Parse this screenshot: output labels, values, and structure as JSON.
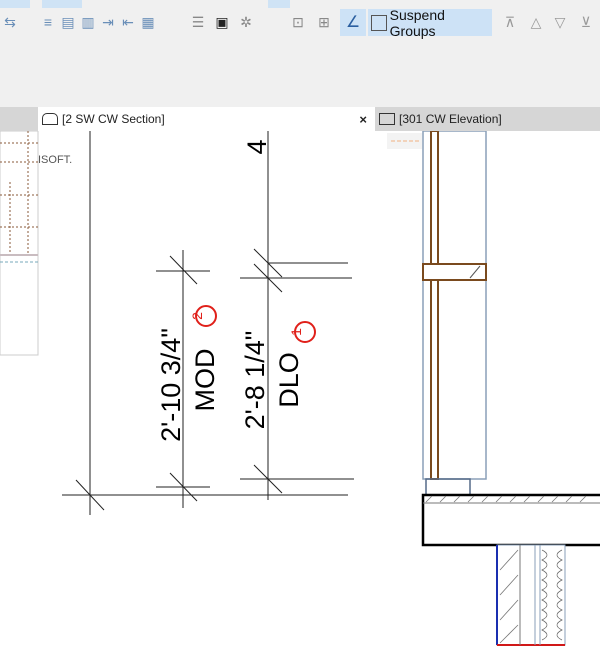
{
  "toolbar": {
    "suspend_groups_label": "Suspend Groups"
  },
  "tabs": [
    {
      "label": "[2 SW CW Section]",
      "active": true
    },
    {
      "label": "[301 CW Elevation]",
      "active": false
    }
  ],
  "close_symbol": "×",
  "side_panel": {
    "text": "ISOFT."
  },
  "section": {
    "grid_label": "4",
    "dims": [
      {
        "value": "2'-10 3/4\"",
        "label": "MOD",
        "markup": "2"
      },
      {
        "value": "2'-8 1/4\"",
        "label": "DLO",
        "markup": "1"
      }
    ]
  },
  "colors": {
    "accent": "#cde2f6",
    "markup": "#e0201a",
    "mullion": "#7a4a1e",
    "wall_edge": "#1a2fb0",
    "wall_bottom": "#d01818"
  }
}
